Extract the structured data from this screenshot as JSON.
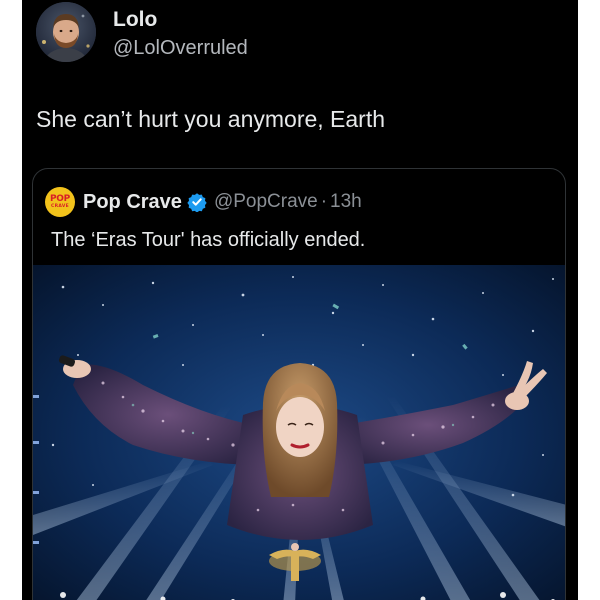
{
  "tweet": {
    "author": {
      "display_name": "Lolo",
      "handle": "@LolOverruled",
      "avatar": "profile-photo"
    },
    "text": "She can’t hurt you anymore, Earth"
  },
  "quoted_tweet": {
    "author": {
      "logo_text_top": "POP",
      "logo_text_bottom": "CRAVE",
      "display_name": "Pop Crave",
      "verified_icon": "verified-badge-icon",
      "handle": "@PopCrave",
      "separator": "·",
      "time": "13h"
    },
    "text": "The ‘Eras Tour' has officially ended.",
    "media": "concert-photo-performer-arms-outstretched"
  },
  "colors": {
    "background": "#000000",
    "text": "#e7e9ea",
    "secondary_text": "#8b9096",
    "border": "#2f3336",
    "verified": "#1d9bf0",
    "logo_yellow": "#f2c21b"
  }
}
